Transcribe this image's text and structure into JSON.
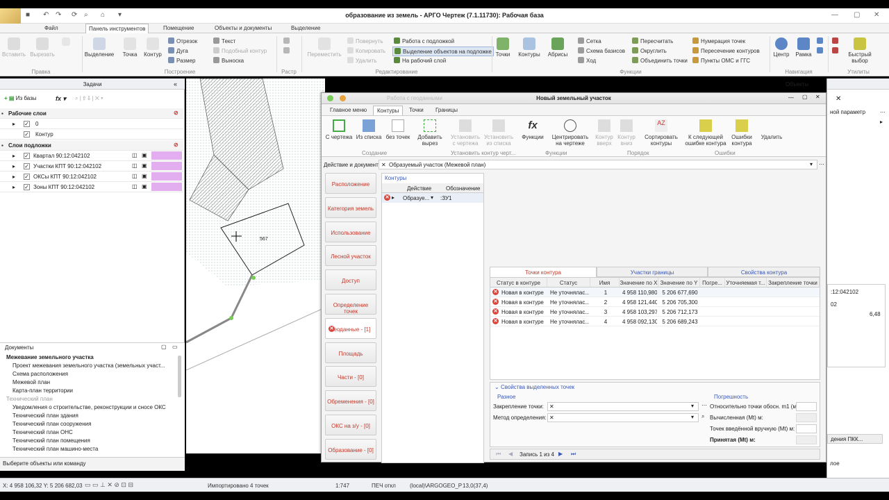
{
  "window": {
    "title": "образование из земель - АРГО Чертеж (7.1.11730): Рабочая база"
  },
  "menu": {
    "tabs": [
      "Файл",
      "Панель инструментов",
      "Помещение",
      "Объекты и документы",
      "Выделение"
    ]
  },
  "ribbon": {
    "buttons": {
      "insert": "Вставить",
      "cut": "Вырезать",
      "select": "Выделение",
      "point": "Точка",
      "contour": "Контур",
      "move": "Переместить",
      "points": "Точки",
      "contours": "Контуры",
      "abrisy": "Абрисы",
      "center": "Центр",
      "frame": "Рамка",
      "quick": "Быстрый выбор"
    },
    "small": {
      "segment": "Отрезок",
      "arc": "Дуга",
      "size": "Размер",
      "text": "Текст",
      "similar": "Подобный контур",
      "callout": "Выноска",
      "rotate": "Повернуть",
      "copy": "Копировать",
      "delete": "Удалить",
      "work_with_base": "Работа с подложкой",
      "select_on_base": "Выделение объектов на подложке",
      "to_working_layer": "На рабочий слой",
      "grid": "Сетка",
      "basis_scheme": "Схема базисов",
      "course": "Ход",
      "recalc": "Пересчитать",
      "round": "Округлить",
      "merge_points": "Объединить точки",
      "numbering": "Нумерация точек",
      "intersection": "Пересечение контуров",
      "oms": "Пункты ОМС и ГГС"
    },
    "groups": [
      "Правка",
      "Построение",
      "Растр",
      "Редактирование",
      "Функции",
      "Навигация",
      "Утилиты"
    ]
  },
  "left": {
    "tasks_title": "Задачи",
    "from_base": "Из базы",
    "working_layers": "Рабочие слои",
    "layers": [
      "0",
      "Контур"
    ],
    "base_layers": "Слои подложки",
    "base": [
      "Квартал 90:12:042102",
      "Участки КПТ 90:12:042102",
      "ОКСы КПТ 90:12:042102",
      "Зоны КПТ 90:12:042102"
    ],
    "docs_title": "Документы",
    "docs": [
      {
        "t": "Межевание земельного участка",
        "k": "hdr"
      },
      {
        "t": "Проект межевания земельного участка (земельных участ...",
        "k": ""
      },
      {
        "t": "Схема расположения",
        "k": ""
      },
      {
        "t": "Межевой план",
        "k": ""
      },
      {
        "t": "Карта-план территории",
        "k": ""
      },
      {
        "t": "Технический план",
        "k": "grey"
      },
      {
        "t": "Уведомления о строительстве, реконструкции и сносе ОКС",
        "k": ""
      },
      {
        "t": "Технический план здания",
        "k": ""
      },
      {
        "t": "Технический план сооружения",
        "k": ""
      },
      {
        "t": "Технический план ОНС",
        "k": ""
      },
      {
        "t": "Технический план помещения",
        "k": ""
      },
      {
        "t": "Технический план машино-места",
        "k": ""
      }
    ],
    "status_hint": "Выберите объекты или команду"
  },
  "map": {
    "label": "567"
  },
  "dialog": {
    "bg_title": "Работа с геоданными",
    "title": "Новый земельный участок",
    "tabs": [
      "Главное меню",
      "Контуры",
      "Точки",
      "Границы"
    ],
    "tools": {
      "from_drawing": "С чертежа",
      "from_list": "Из списка",
      "no_points": "без точек",
      "add_cut": "Добавить вырез",
      "set_from_drawing": "Установить с чертежа",
      "set_from_list": "Установить из списка",
      "functions": "Функции",
      "center_on_drawing": "Центрировать на чертеже",
      "up": "Контур вверх",
      "down": "Контур вниз",
      "sort": "Сортировать контуры",
      "next_error": "К следующей ошибке контура",
      "errors": "Ошибки контура",
      "delete": "Удалить"
    },
    "tool_groups": [
      "Создание",
      "Установить контур черт...",
      "Функции",
      "Порядок",
      "Ошибки"
    ],
    "action_label": "Действие и документ:",
    "action_value": "Образуемый участок (Межевой план)",
    "nav": [
      "Расположение",
      "Категория земель",
      "Использование",
      "Лесной участок",
      "Доступ",
      "Определение точек",
      "Геоданные - [1]",
      "Площадь",
      "Части - [0]",
      "Обременения - [0]",
      "ОКС на з/у - [0]",
      "Образование - [0]"
    ],
    "contours": {
      "title": "Контуры",
      "headers": [
        "Действие",
        "Обозначение"
      ],
      "row": [
        "Образуе...",
        ":ЗУ1"
      ]
    },
    "right_tabs": [
      "Точки контура",
      "Участки границы",
      "Свойства контура"
    ],
    "points": {
      "headers": [
        "Статус в контуре",
        "Статус",
        "Имя",
        "Значение по X",
        "Значение по Y",
        "Погре...",
        "Уточняемая т...",
        "Закрепление точки"
      ],
      "rows": [
        [
          "Новая в контуре",
          "Не уточнялас...",
          "1",
          "4 958 110,980",
          "5 206 677,690"
        ],
        [
          "Новая в контуре",
          "Не уточнялас...",
          "2",
          "4 958 121,440",
          "5 206 705,300"
        ],
        [
          "Новая в контуре",
          "Не уточнялас...",
          "3",
          "4 958 103,297",
          "5 206 712,173"
        ],
        [
          "Новая в контуре",
          "Не уточнялас...",
          "4",
          "4 958 092,130",
          "5 206 689,243"
        ]
      ]
    },
    "props": {
      "title": "Свойства выделенных точек",
      "misc": "Разное",
      "fixing": "Закрепление точки:",
      "method": "Метод определения:",
      "accuracy": "Погрешность",
      "rel": "Относительно точки обосн. m1 (м):",
      "calc": "Вычисленная (Mt) м:",
      "manual": "Точек введённой вручную (Mt) м:",
      "accepted": "Принятая (Mt) м:"
    },
    "record": "Запись 1 из 4"
  },
  "right": {
    "title": "Объекты",
    "param": "ной параметр",
    "code": ":12:042102",
    "code2": "02",
    "val": "6,48",
    "btn": "дения ПКК...",
    "tail": "лое"
  },
  "status": {
    "coords": "X: 4 958 106,32 Y: 5 206 682,03",
    "msg": "Импортировано 4 точек",
    "scale": "1:747",
    "print": "ПЕЧ откл",
    "db": "(local)\\ARGOGEO_P",
    "zoom": "13,0(37,4)"
  }
}
